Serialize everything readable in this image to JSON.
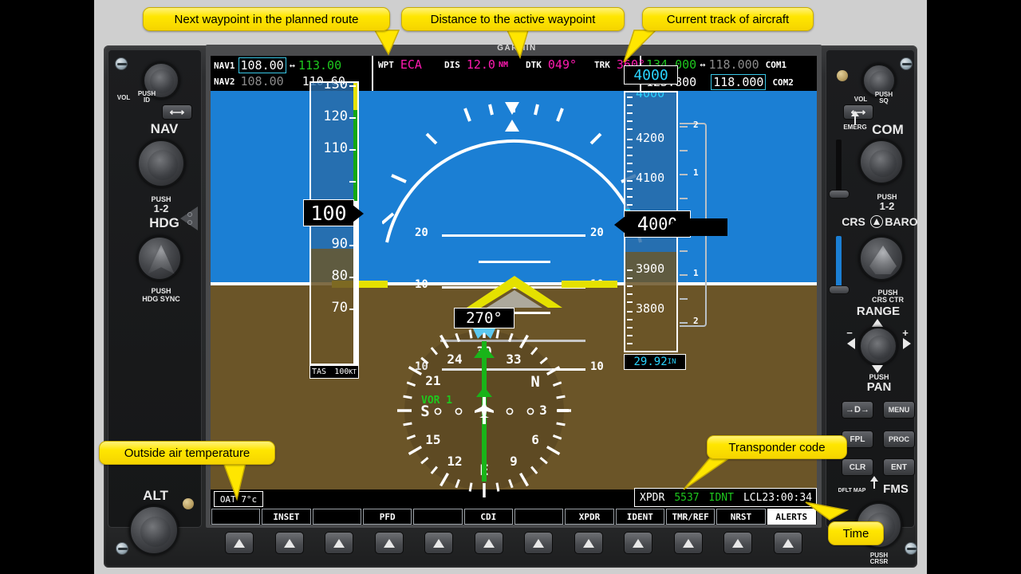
{
  "device": {
    "brand": "GARMIN"
  },
  "callouts": [
    {
      "id": "wpt",
      "text": "Next waypoint in the planned route"
    },
    {
      "id": "dis",
      "text": "Distance to the active waypoint"
    },
    {
      "id": "trk",
      "text": "Current track of aircraft"
    },
    {
      "id": "oat",
      "text": "Outside air temperature"
    },
    {
      "id": "xpdr",
      "text": "Transponder code"
    },
    {
      "id": "time",
      "text": "Time"
    }
  ],
  "pfd": {
    "nav": {
      "nav1_label": "NAV1",
      "nav1_active": "108.00",
      "nav1_standby": "113.00",
      "nav2_label": "NAV2",
      "nav2_active": "108.00",
      "nav2_standby": "110.60",
      "swap_icon": "↔"
    },
    "waypoint": {
      "wpt_label": "WPT",
      "wpt_value": "ECA",
      "dis_label": "DIS",
      "dis_value": "12.0",
      "dis_unit": "NM",
      "dtk_label": "DTK",
      "dtk_value": "049°",
      "trk_label": "TRK",
      "trk_value": "360°"
    },
    "com": {
      "com1_label": "COM1",
      "com1_active": "134.000",
      "com1_standby": "118.000",
      "com2_label": "COM2",
      "com2_active": "123.800",
      "com2_standby": "118.000",
      "swap_icon": "↔"
    },
    "airspeed": {
      "indicated": "100",
      "ticks": [
        "130",
        "120",
        "110",
        "90",
        "80",
        "70"
      ],
      "tas_label": "TAS",
      "tas_value": "100",
      "tas_unit": "KT"
    },
    "attitude": {
      "pitch_labels": [
        "20",
        "20",
        "10",
        "10",
        "10",
        "10"
      ]
    },
    "altimeter": {
      "selected": "4000",
      "current_thousands": "4",
      "current_hundreds": "000",
      "ticks": [
        "4200",
        "4100",
        "3900",
        "3800"
      ],
      "baro": "29.92",
      "baro_unit": "IN"
    },
    "vsi": {
      "ticks_up": [
        "2",
        "1"
      ],
      "ticks_down": [
        "1",
        "2"
      ]
    },
    "hsi": {
      "heading": "270°",
      "source": "VOR 1",
      "rose_labels": [
        "24",
        "21",
        "S",
        "15",
        "12",
        "E",
        "9",
        "6",
        "3",
        "N",
        "33",
        "30"
      ]
    },
    "oat": {
      "label": "OAT",
      "value": "7°c"
    },
    "xpdr": {
      "label": "XPDR",
      "code": "5537",
      "ident": "IDNT"
    },
    "time": {
      "label": "LCL",
      "value": "23:00:34"
    },
    "softkeys": [
      {
        "label": "",
        "active": false
      },
      {
        "label": "INSET",
        "active": false
      },
      {
        "label": "",
        "active": false
      },
      {
        "label": "PFD",
        "active": false
      },
      {
        "label": "",
        "active": false
      },
      {
        "label": "CDI",
        "active": false
      },
      {
        "label": "",
        "active": false
      },
      {
        "label": "XPDR",
        "active": false
      },
      {
        "label": "IDENT",
        "active": false
      },
      {
        "label": "TMR/REF",
        "active": false
      },
      {
        "label": "NRST",
        "active": false
      },
      {
        "label": "ALERTS",
        "active": true
      }
    ]
  },
  "bezel_left": {
    "vol_label": "VOL",
    "push_id_label": "PUSH\nID",
    "vol_text": "VOL",
    "pushid_text": "PUSH",
    "pushid_text2": "ID",
    "nav_label": "NAV",
    "push12_a": "PUSH",
    "push12_b": "1-2",
    "hdg_label": "HDG",
    "hdgsync_a": "PUSH",
    "hdgsync_b": "HDG SYNC",
    "alt_label": "ALT",
    "swap_icon": "⟷"
  },
  "bezel_right": {
    "vol_text": "VOL",
    "pushsq_a": "PUSH",
    "pushsq_b": "SQ",
    "emerg_label": "EMERG",
    "com_label": "COM",
    "push12_a": "PUSH",
    "push12_b": "1-2",
    "crs_label": "CRS",
    "baro_label": "BARO",
    "crsctr_a": "PUSH",
    "crsctr_b": "CRS CTR",
    "range_label": "RANGE",
    "range_minus": "−",
    "range_plus": "+",
    "pan_a": "PUSH",
    "pan_b": "PAN",
    "buttons": [
      "→D→",
      "MENU",
      "FPL",
      "PROC",
      "CLR",
      "ENT"
    ],
    "dfltmap_label": "DFLT MAP",
    "fms_label": "FMS",
    "pushcrsr_a": "PUSH",
    "pushcrsr_b": "CRSR",
    "swap_icon": "⟷"
  },
  "colors": {
    "sky": "#1b7fd4",
    "ground": "#6b5528",
    "magenta": "#ff1ab0",
    "green": "#1ec81e",
    "cyan": "#2ad4ff",
    "callout": "#ffe600",
    "yellow_wing": "#e5e100"
  }
}
